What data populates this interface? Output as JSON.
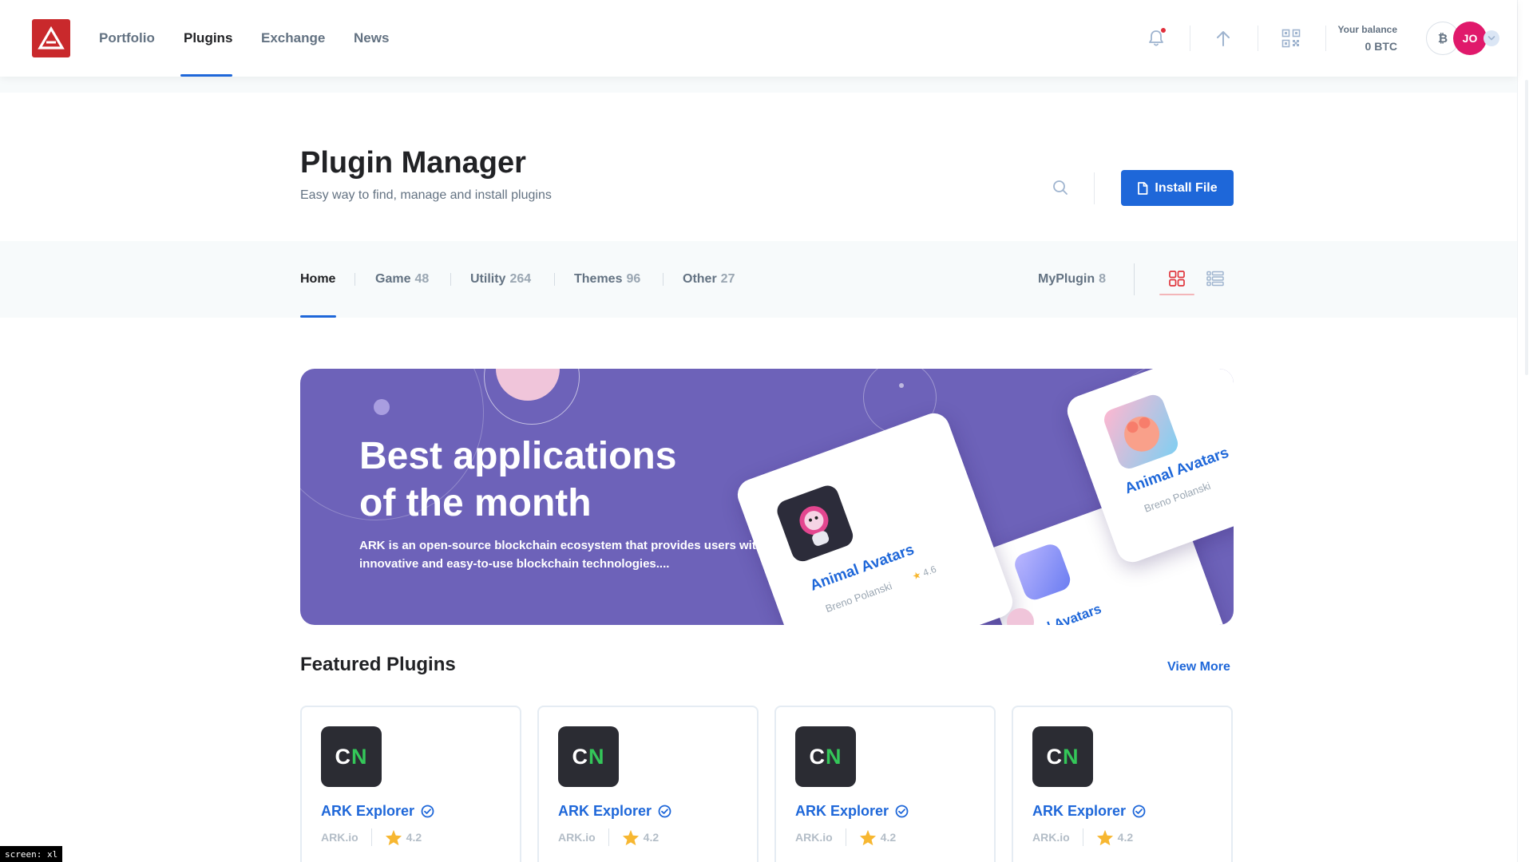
{
  "nav": {
    "links": [
      {
        "label": "Portfolio"
      },
      {
        "label": "Plugins"
      },
      {
        "label": "Exchange"
      },
      {
        "label": "News"
      }
    ],
    "active": "Plugins",
    "icons": [
      "bell-icon",
      "arrow-up-icon",
      "qr-code-icon"
    ],
    "balance_label": "Your balance",
    "balance_value": "0 BTC",
    "currency_symbol": "₿",
    "avatar_initials": "JO"
  },
  "header": {
    "title": "Plugin Manager",
    "subtitle": "Easy way to find, manage and install plugins",
    "install_button": "Install File"
  },
  "tabs": [
    {
      "label": "Home",
      "count": ""
    },
    {
      "label": "Game",
      "count": "48"
    },
    {
      "label": "Utility",
      "count": "264"
    },
    {
      "label": "Themes",
      "count": "96"
    },
    {
      "label": "Other",
      "count": "27"
    }
  ],
  "my_plugin": {
    "label": "MyPlugin",
    "count": "8"
  },
  "banner": {
    "title_line1": "Best applications",
    "title_line2": "of the month",
    "text": "ARK is an open-source blockchain ecosystem that provides users with innovative and easy-to-use blockchain technologies....",
    "cards": [
      {
        "name": "Animal Avatars",
        "author": "Breno Polanski",
        "rating": "4.6"
      },
      {
        "name": "Animal Avatars",
        "author": "Breno Polanski"
      },
      {
        "name": "mal Avatars"
      }
    ]
  },
  "featured": {
    "title": "Featured Plugins",
    "view_more": "View More",
    "plugins": [
      {
        "logo_c": "C",
        "logo_n": "N",
        "name": "ARK Explorer",
        "author": "ARK.io",
        "rating": "4.2"
      },
      {
        "logo_c": "C",
        "logo_n": "N",
        "name": "ARK Explorer",
        "author": "ARK.io",
        "rating": "4.2"
      },
      {
        "logo_c": "C",
        "logo_n": "N",
        "name": "ARK Explorer",
        "author": "ARK.io",
        "rating": "4.2"
      },
      {
        "logo_c": "C",
        "logo_n": "N",
        "name": "ARK Explorer",
        "author": "ARK.io",
        "rating": "4.2"
      }
    ]
  },
  "screen_tag": "screen: xl",
  "colors": {
    "accent": "#1e67d9",
    "brand": "#c9292c",
    "banner": "#6d62b9",
    "avatar": "#e0196b",
    "star": "#f7b731"
  }
}
